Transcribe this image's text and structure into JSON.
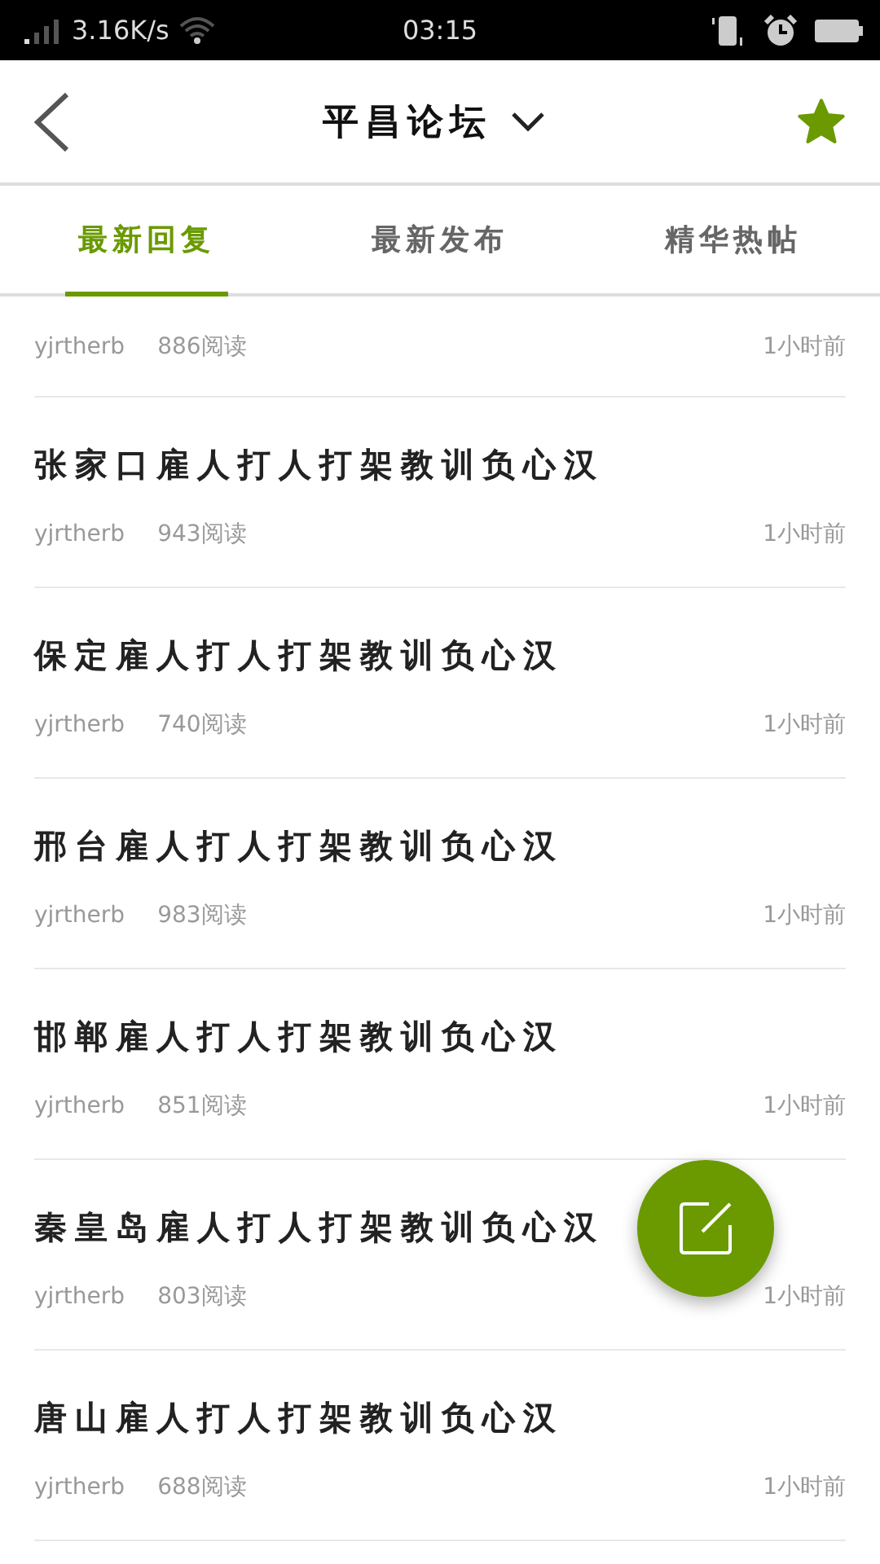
{
  "status_bar": {
    "speed": "3.16K/s",
    "time": "03:15"
  },
  "header": {
    "title": "平昌论坛",
    "starred": true
  },
  "tabs": [
    {
      "label": "最新回复",
      "selected": true
    },
    {
      "label": "最新发布",
      "selected": false
    },
    {
      "label": "精华热帖",
      "selected": false
    }
  ],
  "posts": [
    {
      "author": "yjrtherb",
      "reads": "886阅读",
      "time": "1小时前"
    },
    {
      "title": "张家口雇人打人打架教训负心汉",
      "author": "yjrtherb",
      "reads": "943阅读",
      "time": "1小时前"
    },
    {
      "title": "保定雇人打人打架教训负心汉",
      "author": "yjrtherb",
      "reads": "740阅读",
      "time": "1小时前"
    },
    {
      "title": "邢台雇人打人打架教训负心汉",
      "author": "yjrtherb",
      "reads": "983阅读",
      "time": "1小时前"
    },
    {
      "title": "邯郸雇人打人打架教训负心汉",
      "author": "yjrtherb",
      "reads": "851阅读",
      "time": "1小时前"
    },
    {
      "title": "秦皇岛雇人打人打架教训负心汉",
      "author": "yjrtherb",
      "reads": "803阅读",
      "time": "1小时前"
    },
    {
      "title": "唐山雇人打人打架教训负心汉",
      "author": "yjrtherb",
      "reads": "688阅读",
      "time": "1小时前"
    }
  ]
}
